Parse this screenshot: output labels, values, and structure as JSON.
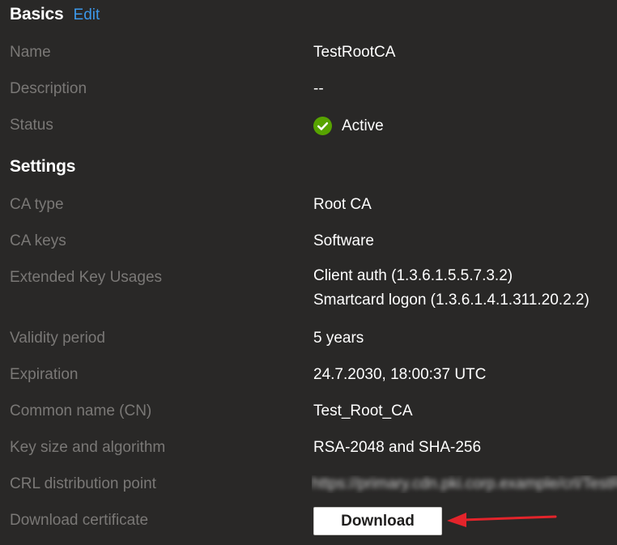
{
  "basics": {
    "title": "Basics",
    "edit_label": "Edit",
    "rows": {
      "name": {
        "label": "Name",
        "value": "TestRootCA"
      },
      "description": {
        "label": "Description",
        "value": "--"
      },
      "status": {
        "label": "Status",
        "value": "Active",
        "icon": "check-circle-icon",
        "icon_color": "#57a300"
      }
    }
  },
  "settings": {
    "title": "Settings",
    "rows": {
      "ca_type": {
        "label": "CA type",
        "value": "Root CA"
      },
      "ca_keys": {
        "label": "CA keys",
        "value": "Software"
      },
      "eku": {
        "label": "Extended Key Usages",
        "values": [
          "Client auth (1.3.6.1.5.5.7.3.2)",
          "Smartcard logon (1.3.6.1.4.1.311.20.2.2)"
        ]
      },
      "validity": {
        "label": "Validity period",
        "value": "5 years"
      },
      "expiration": {
        "label": "Expiration",
        "value": "24.7.2030, 18:00:37 UTC"
      },
      "cn": {
        "label": "Common name (CN)",
        "value": "Test_Root_CA"
      },
      "key_size": {
        "label": "Key size and algorithm",
        "value": "RSA-2048 and SHA-256"
      },
      "crl": {
        "label": "CRL distribution point",
        "value_redacted": "https://primary.cdn.pki.corp.example/crl/TestRootCA.crl"
      },
      "download": {
        "label": "Download certificate",
        "button_label": "Download"
      }
    }
  },
  "colors": {
    "background": "#292827",
    "label": "#7a7876",
    "value": "#ffffff",
    "link": "#3c98ea",
    "annotation_arrow": "#e3242b"
  }
}
